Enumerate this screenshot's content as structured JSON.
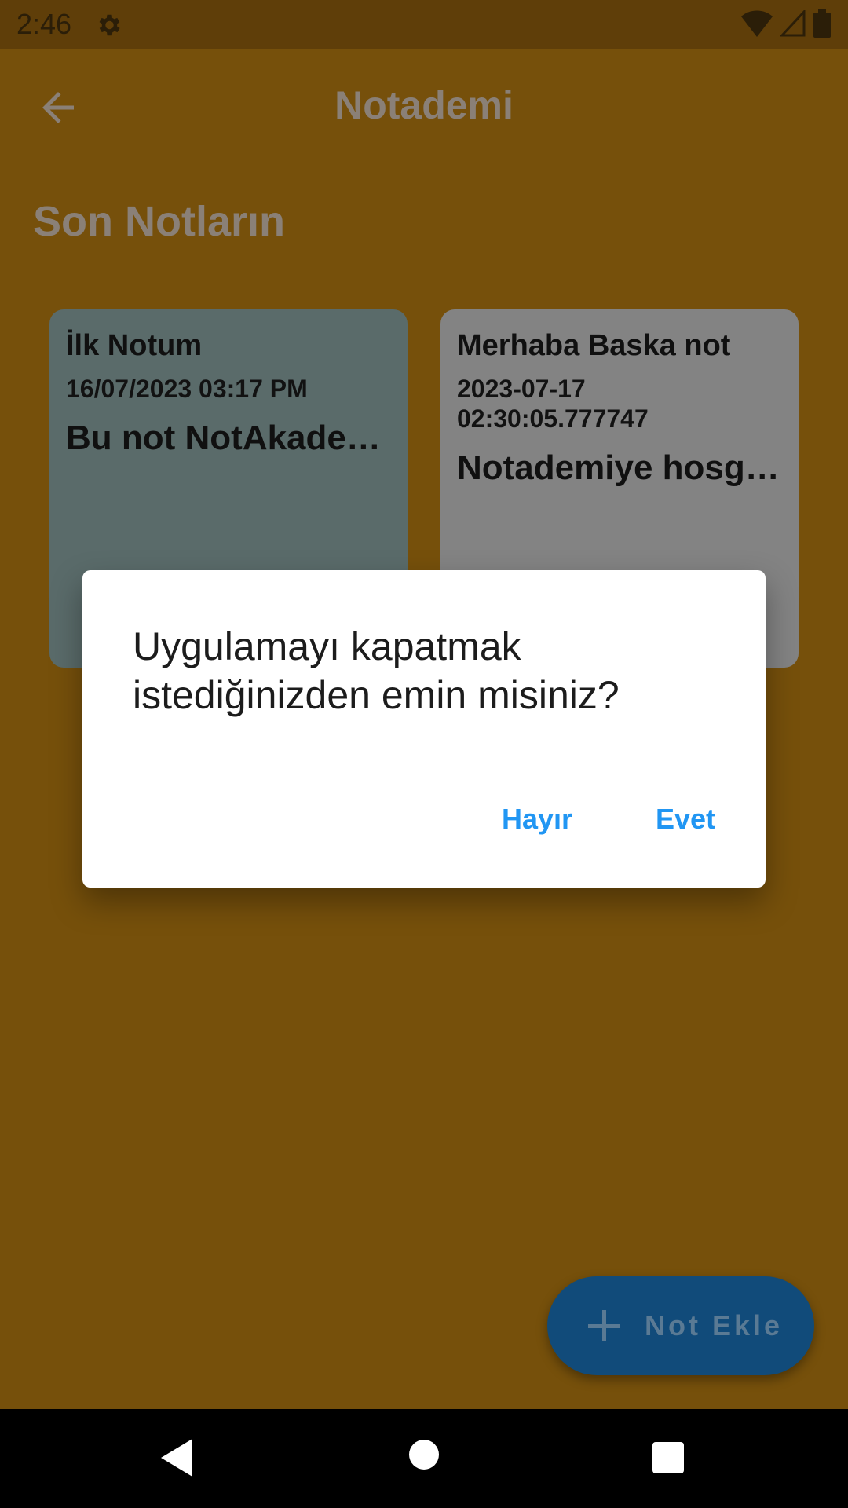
{
  "status_bar": {
    "time": "2:46",
    "icons": [
      "settings-gear-icon",
      "wifi-icon",
      "signal-icon",
      "battery-icon"
    ]
  },
  "app_bar": {
    "title": "Notademi",
    "back_icon": "arrow-left-icon"
  },
  "section": {
    "title": "Son Notların"
  },
  "notes": [
    {
      "title": "İlk Notum",
      "date": "16/07/2023 03:17 PM",
      "body": "Bu not NotAkademi'ye",
      "color": "#5a6b6a"
    },
    {
      "title": "Merhaba Baska not",
      "date": "2023-07-17 02:30:05.777747",
      "body": "Notademiye hosgeldin",
      "color": "#838383"
    }
  ],
  "dialog": {
    "message": "Uygulamayı kapatmak istediğinizden emin misiniz?",
    "cancel_label": "Hayır",
    "confirm_label": "Evet",
    "button_color": "#2196f3"
  },
  "fab": {
    "label": "Not Ekle",
    "icon": "plus-icon"
  },
  "colors": {
    "app_background_dimmed": "#76500b",
    "status_bar_dimmed": "#5f3e09"
  },
  "nav_bar": {
    "buttons": [
      "back-triangle-icon",
      "home-circle-icon",
      "recents-square-icon"
    ]
  }
}
